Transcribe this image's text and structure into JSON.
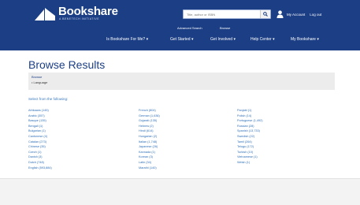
{
  "header": {
    "brand": "Bookshare",
    "tagline": "A BENETECH INITIATIVE",
    "search_placeholder": "Title, author or ISBN",
    "my_account": "My Account",
    "log_out": "Log out",
    "subnav": [
      "Advanced Search",
      "Browse"
    ],
    "mainnav": [
      "Is Bookshare For Me? ▾",
      "Get Started ▾",
      "Get Involved ▾",
      "Help Center ▾",
      "My Bookshare ▾"
    ]
  },
  "page": {
    "title": "Browse Results",
    "browse_label": "Browse",
    "browse_item": "• Language",
    "select_label": "Select from the following:"
  },
  "languages": {
    "col1": [
      "Afrikaans (145)",
      "Arabic (357)",
      "Basque (135)",
      "Bengali (1)",
      "Bulgarian (1)",
      "Cantonese (4)",
      "Catalan (273)",
      "Chinese (35)",
      "Czech (1)",
      "Danish (3)",
      "Dutch (748)",
      "English (593,884)"
    ],
    "col2": [
      "French (804)",
      "German (1,636)",
      "Gujarati (135)",
      "Hebrew (2)",
      "Hindi (614)",
      "Hungarian (2)",
      "Italian (1,748)",
      "Japanese (26)",
      "Kannada (1)",
      "Korean (3)",
      "Latin (34)",
      "Marathi (140)"
    ],
    "col3": [
      "Panjabi (1)",
      "Polish (14)",
      "Portuguese (1,492)",
      "Russian (28)",
      "Spanish (13,733)",
      "Swedish (22)",
      "Tamil (264)",
      "Telugu (172)",
      "Turkish (10)",
      "Vietnamese (1)",
      "Welsh (1)"
    ]
  },
  "colors": {
    "header_bg": "#1b3e85",
    "title": "#1b3e85",
    "link": "#2f6fb8"
  }
}
